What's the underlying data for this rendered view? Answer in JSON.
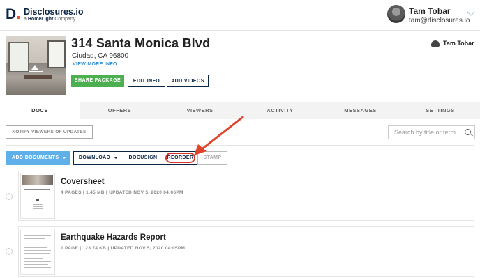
{
  "header": {
    "brand_mark": "D",
    "brand_name": "Disclosures.io",
    "brand_sub_prefix": "a",
    "brand_sub_company": "HomeLight",
    "brand_sub_suffix": "Company",
    "user_name": "Tam Tobar",
    "user_email": "tam@disclosures.io"
  },
  "property": {
    "address": "314 Santa Monica Blvd",
    "city": "Ciudad, CA 96800",
    "view_more": "VIEW MORE INFO",
    "owner": "Tam Tobar",
    "buttons": {
      "share": "SHARE PACKAGE",
      "edit": "EDIT INFO",
      "add_videos": "ADD VIDEOS"
    }
  },
  "tabs": [
    {
      "label": "DOCS",
      "active": true
    },
    {
      "label": "OFFERS"
    },
    {
      "label": "VIEWERS"
    },
    {
      "label": "ACTIVITY"
    },
    {
      "label": "MESSAGES"
    },
    {
      "label": "SETTINGS"
    }
  ],
  "toolbar": {
    "notify": "NOTIFY VIEWERS OF UPDATES",
    "search_placeholder": "Search by title or term",
    "add_documents": "ADD DOCUMENTS",
    "download": "DOWNLOAD",
    "docusign": "DOCUSIGN",
    "reorder": "REORDER",
    "stamp": "STAMP"
  },
  "documents": [
    {
      "title": "Coversheet",
      "meta": "4 PAGES | 1.45 MB | UPDATED NOV 5, 2020 04:06PM"
    },
    {
      "title": "Earthquake Hazards Report",
      "meta": "1 PAGE | 123.74 KB | UPDATED NOV 5, 2020 04:05PM"
    }
  ],
  "colors": {
    "brand_navy": "#0b2545",
    "share_green": "#4caf50",
    "add_docs_blue": "#5fb0e8",
    "link_blue": "#2b8ed6",
    "highlight_red": "#d9342b"
  }
}
